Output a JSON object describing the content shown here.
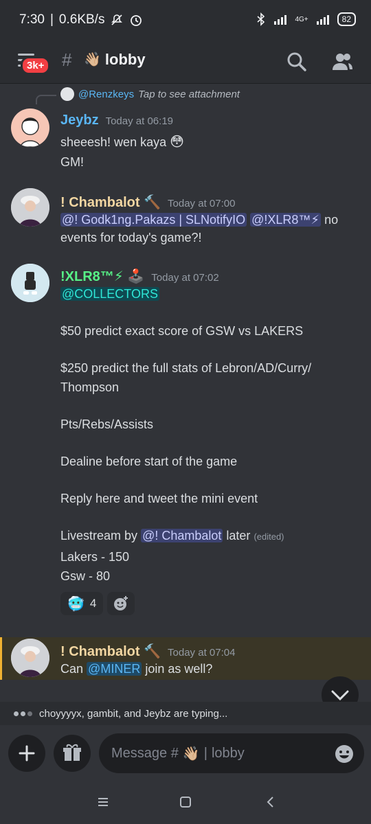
{
  "status": {
    "time": "7:30",
    "speed": "0.6KB/s",
    "network": "4G+",
    "battery": "82"
  },
  "header": {
    "badge": "3k+",
    "channel_emoji": "👋🏼",
    "channel_name": "lobby"
  },
  "reply": {
    "user": "@Renzkeys",
    "text": "Tap to see attachment"
  },
  "messages": [
    {
      "user": "Jeybz",
      "time": "Today at 06:19",
      "name_color": "#5ab6f4",
      "lines": [
        "sheeesh! wen kaya",
        "GM!"
      ],
      "emoji": "😳"
    },
    {
      "user": "! Chambalot",
      "user_emoji": "🔨",
      "time": "Today at 07:00",
      "name_color": "#f2d6a2",
      "mention1": "@! Godk1ng.Pakazs | SLNotifyIO",
      "mention2": "@!XLR8™⚡",
      "text_after": "no",
      "line2": "events for today's game?!"
    },
    {
      "user": "!XLR8™⚡",
      "user_emoji": "🕹️",
      "time": "Today at 07:02",
      "name_color": "#57f287",
      "mention": "@COLLECTORS",
      "lines": [
        "$50 predict exact score of GSW vs LAKERS",
        "$250 predict the full stats of Lebron/AD/Curry/",
        "Thompson",
        "Pts/Rebs/Assists",
        "Dealine before start of the game",
        "Reply here and tweet the mini event"
      ],
      "livestream_prefix": "Livestream by",
      "livestream_mention": "@! Chambalot",
      "livestream_suffix": "later",
      "edited": "(edited)",
      "score1": "Lakers - 150",
      "score2": "Gsw - 80",
      "reaction_emoji": "🥶",
      "reaction_count": "4"
    },
    {
      "user": "! Chambalot",
      "user_emoji": "🔨",
      "time": "Today at 07:04",
      "name_color": "#f2d6a2",
      "prefix": "Can",
      "mention": "@MINER",
      "suffix": "join as well?"
    }
  ],
  "typing": "choyyyyx, gambit, and Jeybz are typing...",
  "composer": {
    "placeholder_prefix": "Message #",
    "placeholder_emoji": "👋🏼",
    "placeholder_channel": "lobby"
  }
}
